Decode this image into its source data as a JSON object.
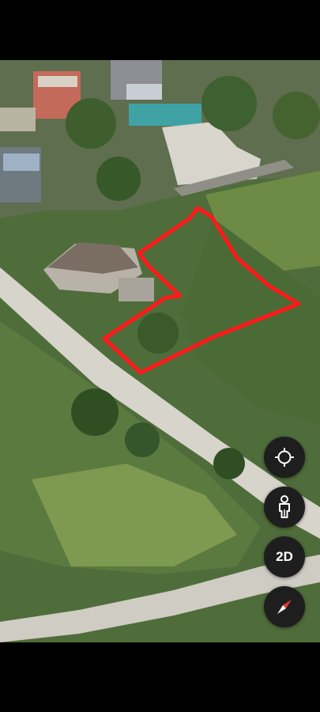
{
  "map": {
    "view_mode": "3D satellite",
    "overlay": {
      "type": "hand-drawn parcel outline",
      "color": "#ff1a1a"
    }
  },
  "controls": {
    "my_location": {
      "icon": "crosshair-location-icon"
    },
    "street_view": {
      "icon": "pegman-icon"
    },
    "view_toggle": {
      "label": "2D",
      "icon": "2d-toggle"
    },
    "compass": {
      "icon": "compass-needle-icon",
      "needle_color": "#e53935"
    }
  },
  "colors": {
    "control_bg": "#1e1e1e",
    "control_fg": "#ffffff",
    "outline": "#ff1a1a"
  }
}
